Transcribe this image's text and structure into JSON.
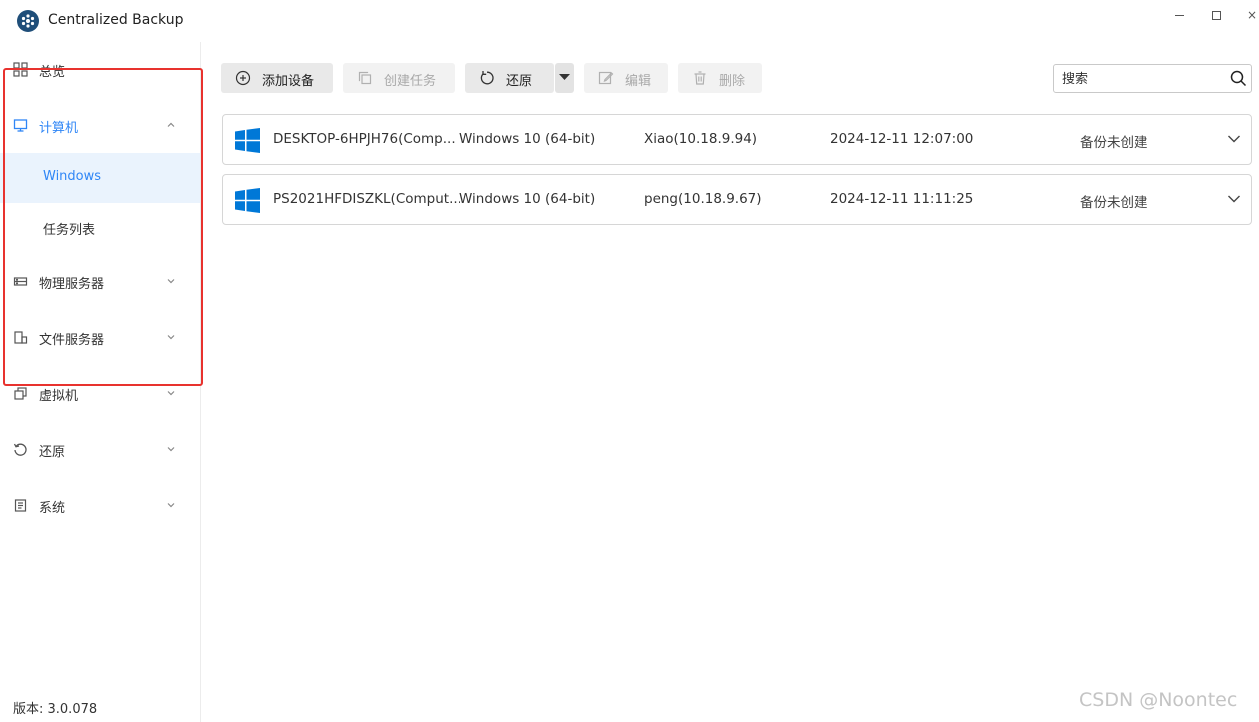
{
  "window": {
    "title": "Centralized Backup",
    "controls": [
      "minimize",
      "maximize",
      "close"
    ],
    "close_glyph": "×"
  },
  "sidebar": {
    "items": [
      {
        "label": "总览",
        "icon": "grid-icon",
        "expanded": false
      },
      {
        "label": "计算机",
        "icon": "monitor-icon",
        "expanded": true,
        "children": [
          {
            "label": "Windows",
            "selected": true
          },
          {
            "label": "任务列表",
            "selected": false
          }
        ]
      },
      {
        "label": "物理服务器",
        "icon": "server-icon",
        "expanded": false
      },
      {
        "label": "文件服务器",
        "icon": "file-server-icon",
        "expanded": false
      },
      {
        "label": "虚拟机",
        "icon": "virtual-machine-icon",
        "expanded": false
      },
      {
        "label": "还原",
        "icon": "restore-icon",
        "expanded": false
      },
      {
        "label": "系统",
        "icon": "system-icon",
        "expanded": false
      }
    ],
    "version": "版本: 3.0.078"
  },
  "toolbar": {
    "add_device": "添加设备",
    "create_task": "创建任务",
    "restore": "还原",
    "edit": "编辑",
    "delete": "删除",
    "search_placeholder": "搜索"
  },
  "devices": [
    {
      "name": "DESKTOP-6HPJH76(Comp...",
      "os": "Windows 10 (64-bit)",
      "user": "Xiao(10.18.9.94)",
      "time": "2024-12-11 12:07:00",
      "status": "备份未创建"
    },
    {
      "name": "PS2021HFDISZKL(Comput...",
      "os": "Windows 10 (64-bit)",
      "user": "peng(10.18.9.67)",
      "time": "2024-12-11 11:11:25",
      "status": "备份未创建"
    }
  ],
  "watermark": "CSDN @Noontec",
  "colors": {
    "accent": "#2f86f6",
    "highlight": "#e8322e",
    "windows_blue": "#0078d7"
  }
}
